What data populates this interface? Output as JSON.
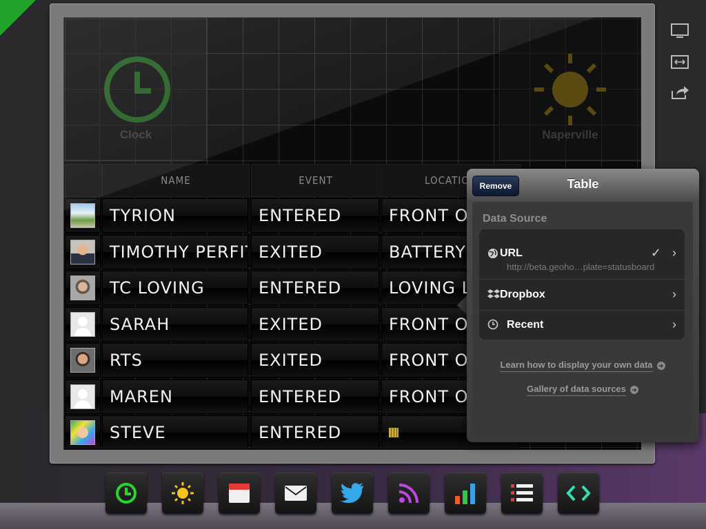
{
  "widgets": {
    "clock": {
      "label": "Clock"
    },
    "weather": {
      "label": "Naperville"
    }
  },
  "table": {
    "headers": [
      "",
      "NAME",
      "EVENT",
      "LOCATION"
    ],
    "rows": [
      {
        "name": "TYRION",
        "event": "ENTERED",
        "location": "FRONT OFFICE",
        "avatar": "photo-plant"
      },
      {
        "name": "TIMOTHY PERFITT",
        "event": "EXITED",
        "location": "BATTERY B",
        "avatar": "photo-man-suit"
      },
      {
        "name": "TC LOVING",
        "event": "ENTERED",
        "location": "LOVING LO",
        "avatar": "photo-woman-glasses"
      },
      {
        "name": "SARAH",
        "event": "EXITED",
        "location": "FRONT OFFICE",
        "avatar": "generic"
      },
      {
        "name": "RTS",
        "event": "EXITED",
        "location": "FRONT OFFICE",
        "avatar": "photo-man"
      },
      {
        "name": "MAREN",
        "event": "ENTERED",
        "location": "FRONT OFFICE",
        "avatar": "generic"
      },
      {
        "name": "STEVE",
        "event": "ENTERED",
        "location": "",
        "avatar": "photo-cartoon"
      }
    ]
  },
  "popover": {
    "title": "Table",
    "remove_label": "Remove",
    "data_source_label": "Data Source",
    "items": [
      {
        "label": "URL",
        "sub": "http://beta.geoho…plate=statusboard",
        "icon": "globe-icon",
        "checked": true
      },
      {
        "label": "Dropbox",
        "icon": "dropbox-icon"
      },
      {
        "label": "Recent",
        "icon": "clock-icon"
      }
    ],
    "link_learn": "Learn how to display your own data",
    "link_gallery": "Gallery of data sources"
  },
  "dock": {
    "items": [
      "clock-icon",
      "sun-icon",
      "calendar-icon",
      "mail-icon",
      "twitter-icon",
      "rss-icon",
      "bar-chart-icon",
      "list-icon",
      "code-icon"
    ],
    "colors": {
      "clock": "#28d62b",
      "sun": "#f6c21a",
      "calendar": "#e53935",
      "mail": "#f0f0f0",
      "twitter": "#34a8e8",
      "rss": "#c046e0",
      "chart": "#f5c518",
      "list": "#e53935",
      "code": "#2fe0b2"
    }
  },
  "status": {
    "corner_check_color": "#1fa32a"
  }
}
